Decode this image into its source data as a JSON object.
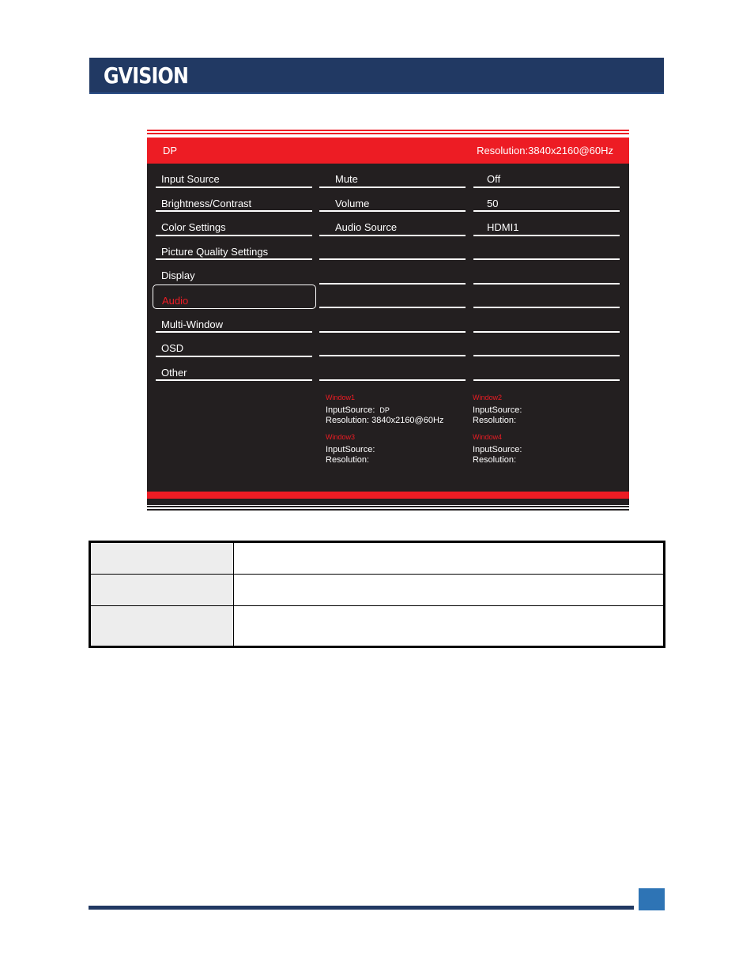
{
  "header": {
    "logo_text": "GVISION"
  },
  "osd": {
    "input_source": "DP",
    "resolution_label": "Resolution:3840x2160@60Hz",
    "menu": [
      {
        "label": "Input Source",
        "selected": false
      },
      {
        "label": "Brightness/Contrast",
        "selected": false
      },
      {
        "label": "Color Settings",
        "selected": false
      },
      {
        "label": "Picture Quality Settings",
        "selected": false
      },
      {
        "label": "Display",
        "selected": false
      },
      {
        "label": "Audio",
        "selected": true
      },
      {
        "label": "Multi-Window",
        "selected": false
      },
      {
        "label": "OSD",
        "selected": false
      },
      {
        "label": "Other",
        "selected": false
      }
    ],
    "submenu": [
      {
        "label": "Mute",
        "value": "Off"
      },
      {
        "label": "Volume",
        "value": "50"
      },
      {
        "label": "Audio Source",
        "value": "HDMI1"
      },
      {
        "label": "",
        "value": ""
      },
      {
        "label": "",
        "value": ""
      },
      {
        "label": "",
        "value": ""
      },
      {
        "label": "",
        "value": ""
      },
      {
        "label": "",
        "value": ""
      },
      {
        "label": "",
        "value": ""
      }
    ],
    "windows": [
      {
        "title": "Window1",
        "input_label": "InputSource:",
        "input_value": "DP",
        "res_label": "Resolution:",
        "res_value": "3840x2160@60Hz"
      },
      {
        "title": "Window2",
        "input_label": "InputSource:",
        "input_value": "",
        "res_label": "Resolution:",
        "res_value": ""
      },
      {
        "title": "Window3",
        "input_label": "InputSource:",
        "input_value": "",
        "res_label": "Resolution:",
        "res_value": ""
      },
      {
        "title": "Window4",
        "input_label": "InputSource:",
        "input_value": "",
        "res_label": "Resolution:",
        "res_value": ""
      }
    ]
  },
  "table": {
    "rows": [
      {
        "key": "",
        "value": ""
      },
      {
        "key": "",
        "value": ""
      },
      {
        "key": "",
        "value": ""
      }
    ]
  },
  "colors": {
    "brand_navy": "#213963",
    "osd_red": "#ed1c24",
    "osd_dark": "#231f20",
    "footer_blue": "#2e74b5"
  }
}
